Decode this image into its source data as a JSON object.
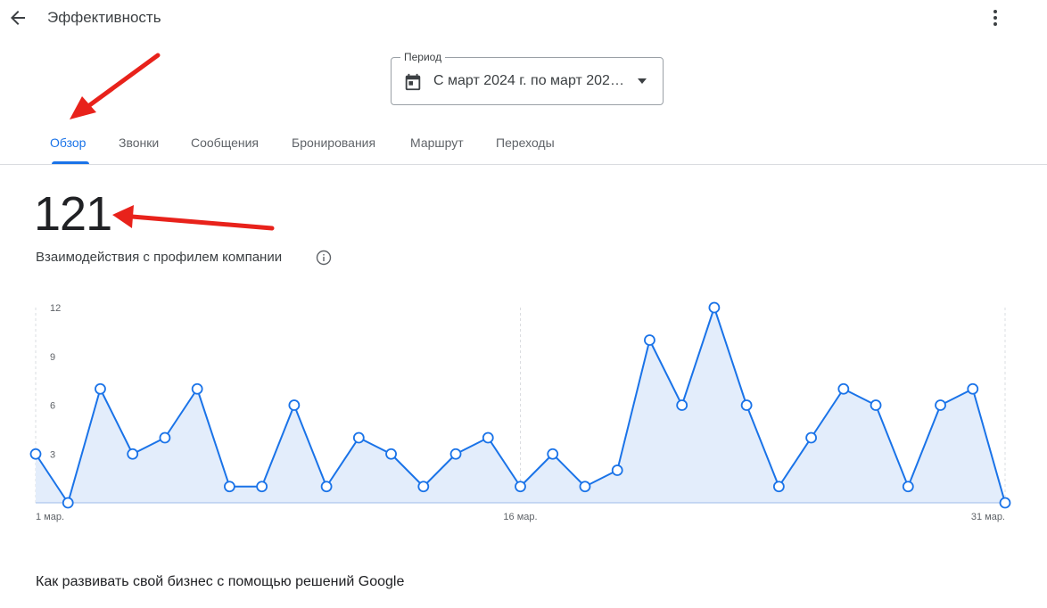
{
  "header": {
    "title": "Эффективность",
    "back_icon": "arrow-back-icon",
    "more_icon": "more-vert-icon"
  },
  "period": {
    "label": "Период",
    "value": "С март 2024 г. по март 202…",
    "icon": "calendar-icon"
  },
  "tabs": [
    {
      "label": "Обзор",
      "active": true
    },
    {
      "label": "Звонки",
      "active": false
    },
    {
      "label": "Сообщения",
      "active": false
    },
    {
      "label": "Бронирования",
      "active": false
    },
    {
      "label": "Маршрут",
      "active": false
    },
    {
      "label": "Переходы",
      "active": false
    }
  ],
  "metric": {
    "value": "121",
    "label": "Взаимодействия с профилем компании"
  },
  "colors": {
    "accent": "#1a73e8",
    "line": "#1a73e8",
    "fill": "#e3edfb",
    "annotation": "#e8221b"
  },
  "chart_data": {
    "type": "area",
    "x": [
      "1 мар.",
      "2",
      "3",
      "4",
      "5",
      "6",
      "7",
      "8",
      "9",
      "10",
      "11",
      "12",
      "13",
      "14",
      "15",
      "16 мар.",
      "17",
      "18",
      "19",
      "20",
      "21",
      "22",
      "23",
      "24",
      "25",
      "26",
      "27",
      "28",
      "29",
      "30",
      "31 мар."
    ],
    "x_tick_labels": [
      "1 мар.",
      "16 мар.",
      "31 мар."
    ],
    "y_tick_labels": [
      "3",
      "6",
      "9",
      "12"
    ],
    "series": [
      {
        "values": [
          3,
          0,
          7,
          3,
          4,
          7,
          1,
          1,
          6,
          1,
          4,
          3,
          1,
          3,
          4,
          1,
          3,
          1,
          2,
          10,
          6,
          12,
          6,
          1,
          4,
          7,
          6,
          1,
          6,
          7,
          0
        ]
      }
    ],
    "ylim": [
      0,
      12
    ],
    "grid": "vertical dashed",
    "markers": "hollow circles"
  },
  "footer": {
    "text": "Как развивать свой бизнес с помощью решений Google"
  }
}
